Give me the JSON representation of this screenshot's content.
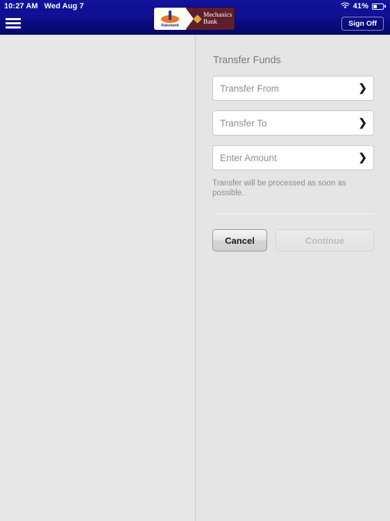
{
  "status_bar": {
    "time": "10:27 AM",
    "date": "Wed Aug 7",
    "wifi_icon": "wifi-icon",
    "battery_percent": "41%",
    "battery_level": 41
  },
  "nav_bar": {
    "menu_icon": "hamburger-menu-icon",
    "sign_off_label": "Sign Off"
  },
  "logo": {
    "primary_brand": "Rabobank",
    "secondary_brand_line1": "Mechanics",
    "secondary_brand_line2": "Bank",
    "diamond_icon": "diamond-icon",
    "colors": {
      "maroon": "#5e1f2c",
      "cream": "#fdfcf7",
      "orange": "#ef7622",
      "gold": "#e8a33d",
      "navy": "#1b3a8f"
    }
  },
  "panel": {
    "title": "Transfer Funds",
    "fields": [
      {
        "label": "Transfer From",
        "chevron": "❯",
        "icon": "chevron-right-icon"
      },
      {
        "label": "Transfer To",
        "chevron": "❯",
        "icon": "chevron-right-icon"
      },
      {
        "label": "Enter Amount",
        "chevron": "❯",
        "icon": "chevron-right-icon"
      }
    ],
    "hint": "Transfer will be processed as soon as possible.",
    "buttons": {
      "cancel": "Cancel",
      "continue": "Continue"
    }
  },
  "theme": {
    "nav_blue": "#0b0b7e",
    "page_gray": "#e5e5e5",
    "field_white": "#ffffff",
    "text_gray": "#8e8e8e"
  }
}
